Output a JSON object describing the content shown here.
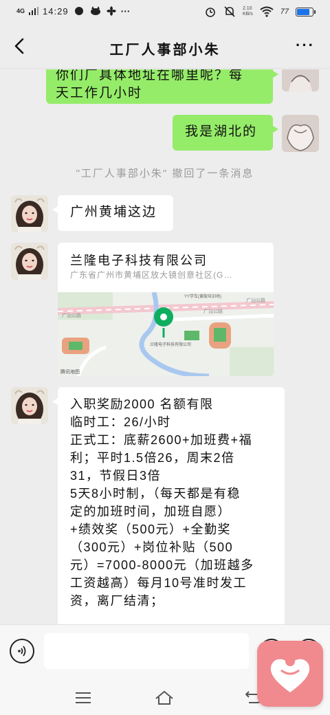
{
  "status_bar": {
    "network": "4G",
    "time": "14:29",
    "speed": "2.10",
    "speed_unit": "KB/s",
    "battery": "77"
  },
  "header": {
    "title": "工厂人事部小朱"
  },
  "messages": {
    "sent_1_line1": "你们厂具体地址在哪里呢？每",
    "sent_1_line2": "天工作几小时",
    "sent_2": "我是湖北的",
    "recall_notice": "\"工厂人事部小朱\" 撤回了一条消息",
    "received_1": "广州黄埔这边",
    "location": {
      "name": "兰隆电子科技有限公司",
      "address": "广东省广州市黄埔区放大镜创意社区(G…",
      "map_labels": {
        "road_1": "广汕公路",
        "road_2": "广汕公路",
        "road_3": "广汕公路",
        "poi_1": "YY学车(黄陂培训场)",
        "poi_2": "兰隆电子科技有限公司",
        "watermark": "腾讯地图"
      }
    },
    "received_long": [
      "入职奖励2000 名额有限",
      "临时工：26/小时",
      "正式工：底薪2600+加班费+福",
      "利；平时1.5倍26，周末2倍",
      "31，节假日3倍",
      "5天8小时制，（每天都是有稳",
      "定的加班时间，加班自愿）",
      "+绩效奖（500元）+全勤奖",
      "（300元）+岗位补贴（500",
      "元）=7000-8000元（加班越多",
      "工资越高）每月10号准时发工",
      "资，离厂结清；"
    ]
  },
  "input": {
    "placeholder": ""
  }
}
